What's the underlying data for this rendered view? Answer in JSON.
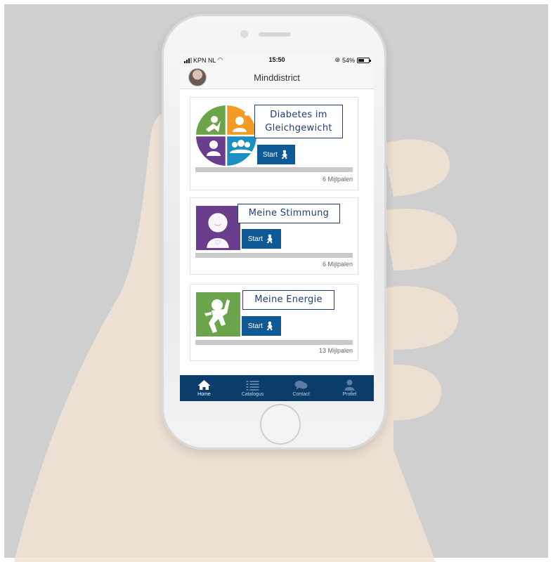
{
  "status_bar": {
    "carrier": "KPN NL",
    "time": "15:50",
    "battery": "54%",
    "battery_level": 0.54
  },
  "app": {
    "title": "Minddistrict"
  },
  "modules": [
    {
      "title_line1": "Diabetes im",
      "title_line2": "Gleichgewicht",
      "start_label": "Start",
      "milestones": "6 Mijlpalen",
      "progress": 0,
      "colors": {
        "green": "#6ba44a",
        "orange": "#f29a23",
        "purple": "#6a3e8c",
        "blue": "#1b8fc1"
      }
    },
    {
      "title": "Meine Stimmung",
      "start_label": "Start",
      "milestones": "6 Mijlpalen",
      "progress": 0,
      "color": "#6a3e8c"
    },
    {
      "title": "Meine Energie",
      "start_label": "Start",
      "milestones": "13 Mijlpalen",
      "progress": 0,
      "color": "#6ba44a"
    }
  ],
  "tabs": [
    {
      "label": "Home",
      "icon": "home-icon",
      "active": true
    },
    {
      "label": "Catalogus",
      "icon": "list-icon",
      "active": false
    },
    {
      "label": "Contact",
      "icon": "chat-icon",
      "active": false
    },
    {
      "label": "Profiel",
      "icon": "user-icon",
      "active": false
    }
  ],
  "colors": {
    "primary": "#0e5a96",
    "tab_bar": "#0b3d6a",
    "title_border": "#1f3e7a"
  }
}
